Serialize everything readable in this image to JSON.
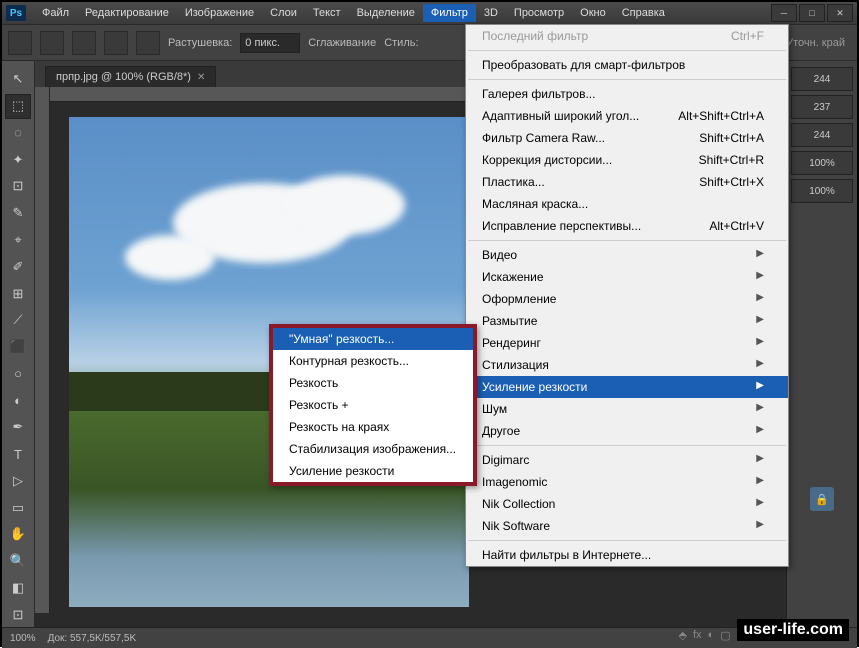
{
  "app": {
    "logo": "Ps"
  },
  "menu": {
    "items": [
      "Файл",
      "Редактирование",
      "Изображение",
      "Слои",
      "Текст",
      "Выделение",
      "Фильтр",
      "3D",
      "Просмотр",
      "Окно",
      "Справка"
    ],
    "open_index": 6
  },
  "options": {
    "feather_label": "Растушевка:",
    "feather_value": "0 пикс.",
    "antialias": "Сглаживание",
    "style": "Стиль:",
    "right_trunc": "Уточн. край"
  },
  "doc_tab": {
    "title": "прпр.jpg @ 100% (RGB/8*)"
  },
  "filter_menu": {
    "last": {
      "label": "Последний фильтр",
      "shortcut": "Ctrl+F",
      "disabled": true
    },
    "smart": {
      "label": "Преобразовать для смарт-фильтров"
    },
    "gallery": {
      "label": "Галерея фильтров..."
    },
    "adaptive": {
      "label": "Адаптивный широкий угол...",
      "shortcut": "Alt+Shift+Ctrl+A"
    },
    "cameraraw": {
      "label": "Фильтр Camera Raw...",
      "shortcut": "Shift+Ctrl+A"
    },
    "lens": {
      "label": "Коррекция дисторсии...",
      "shortcut": "Shift+Ctrl+R"
    },
    "liquify": {
      "label": "Пластика...",
      "shortcut": "Shift+Ctrl+X"
    },
    "oil": {
      "label": "Масляная краска..."
    },
    "vanish": {
      "label": "Исправление перспективы...",
      "shortcut": "Alt+Ctrl+V"
    },
    "groups": [
      "Видео",
      "Искажение",
      "Оформление",
      "Размытие",
      "Рендеринг",
      "Стилизация",
      "Усиление резкости",
      "Шум",
      "Другое"
    ],
    "plugins": [
      "Digimarc",
      "Imagenomic",
      "Nik Collection",
      "Nik Software"
    ],
    "browse": "Найти фильтры в Интернете...",
    "hover_group_index": 6
  },
  "sharpen_submenu": {
    "items": [
      "\"Умная\" резкость...",
      "Контурная резкость...",
      "Резкость",
      "Резкость +",
      "Резкость на краях",
      "Стабилизация изображения...",
      "Усиление резкости"
    ],
    "hover_index": 0
  },
  "status": {
    "zoom": "100%",
    "doc": "Док: 557,5K/557,5K"
  },
  "rpanel": {
    "v1": "244",
    "v2": "237",
    "v3": "244",
    "opacity": "100%",
    "fill": "100%"
  },
  "tools_glyphs": [
    "▸",
    "⬚",
    "◌",
    "✦",
    "⊡",
    "✎",
    "⌖",
    "✐",
    "⊞",
    "⟋",
    "⬛",
    "T",
    "▷",
    "✋",
    "◧",
    "⊡",
    "Q"
  ],
  "watermark": "user-life.com"
}
